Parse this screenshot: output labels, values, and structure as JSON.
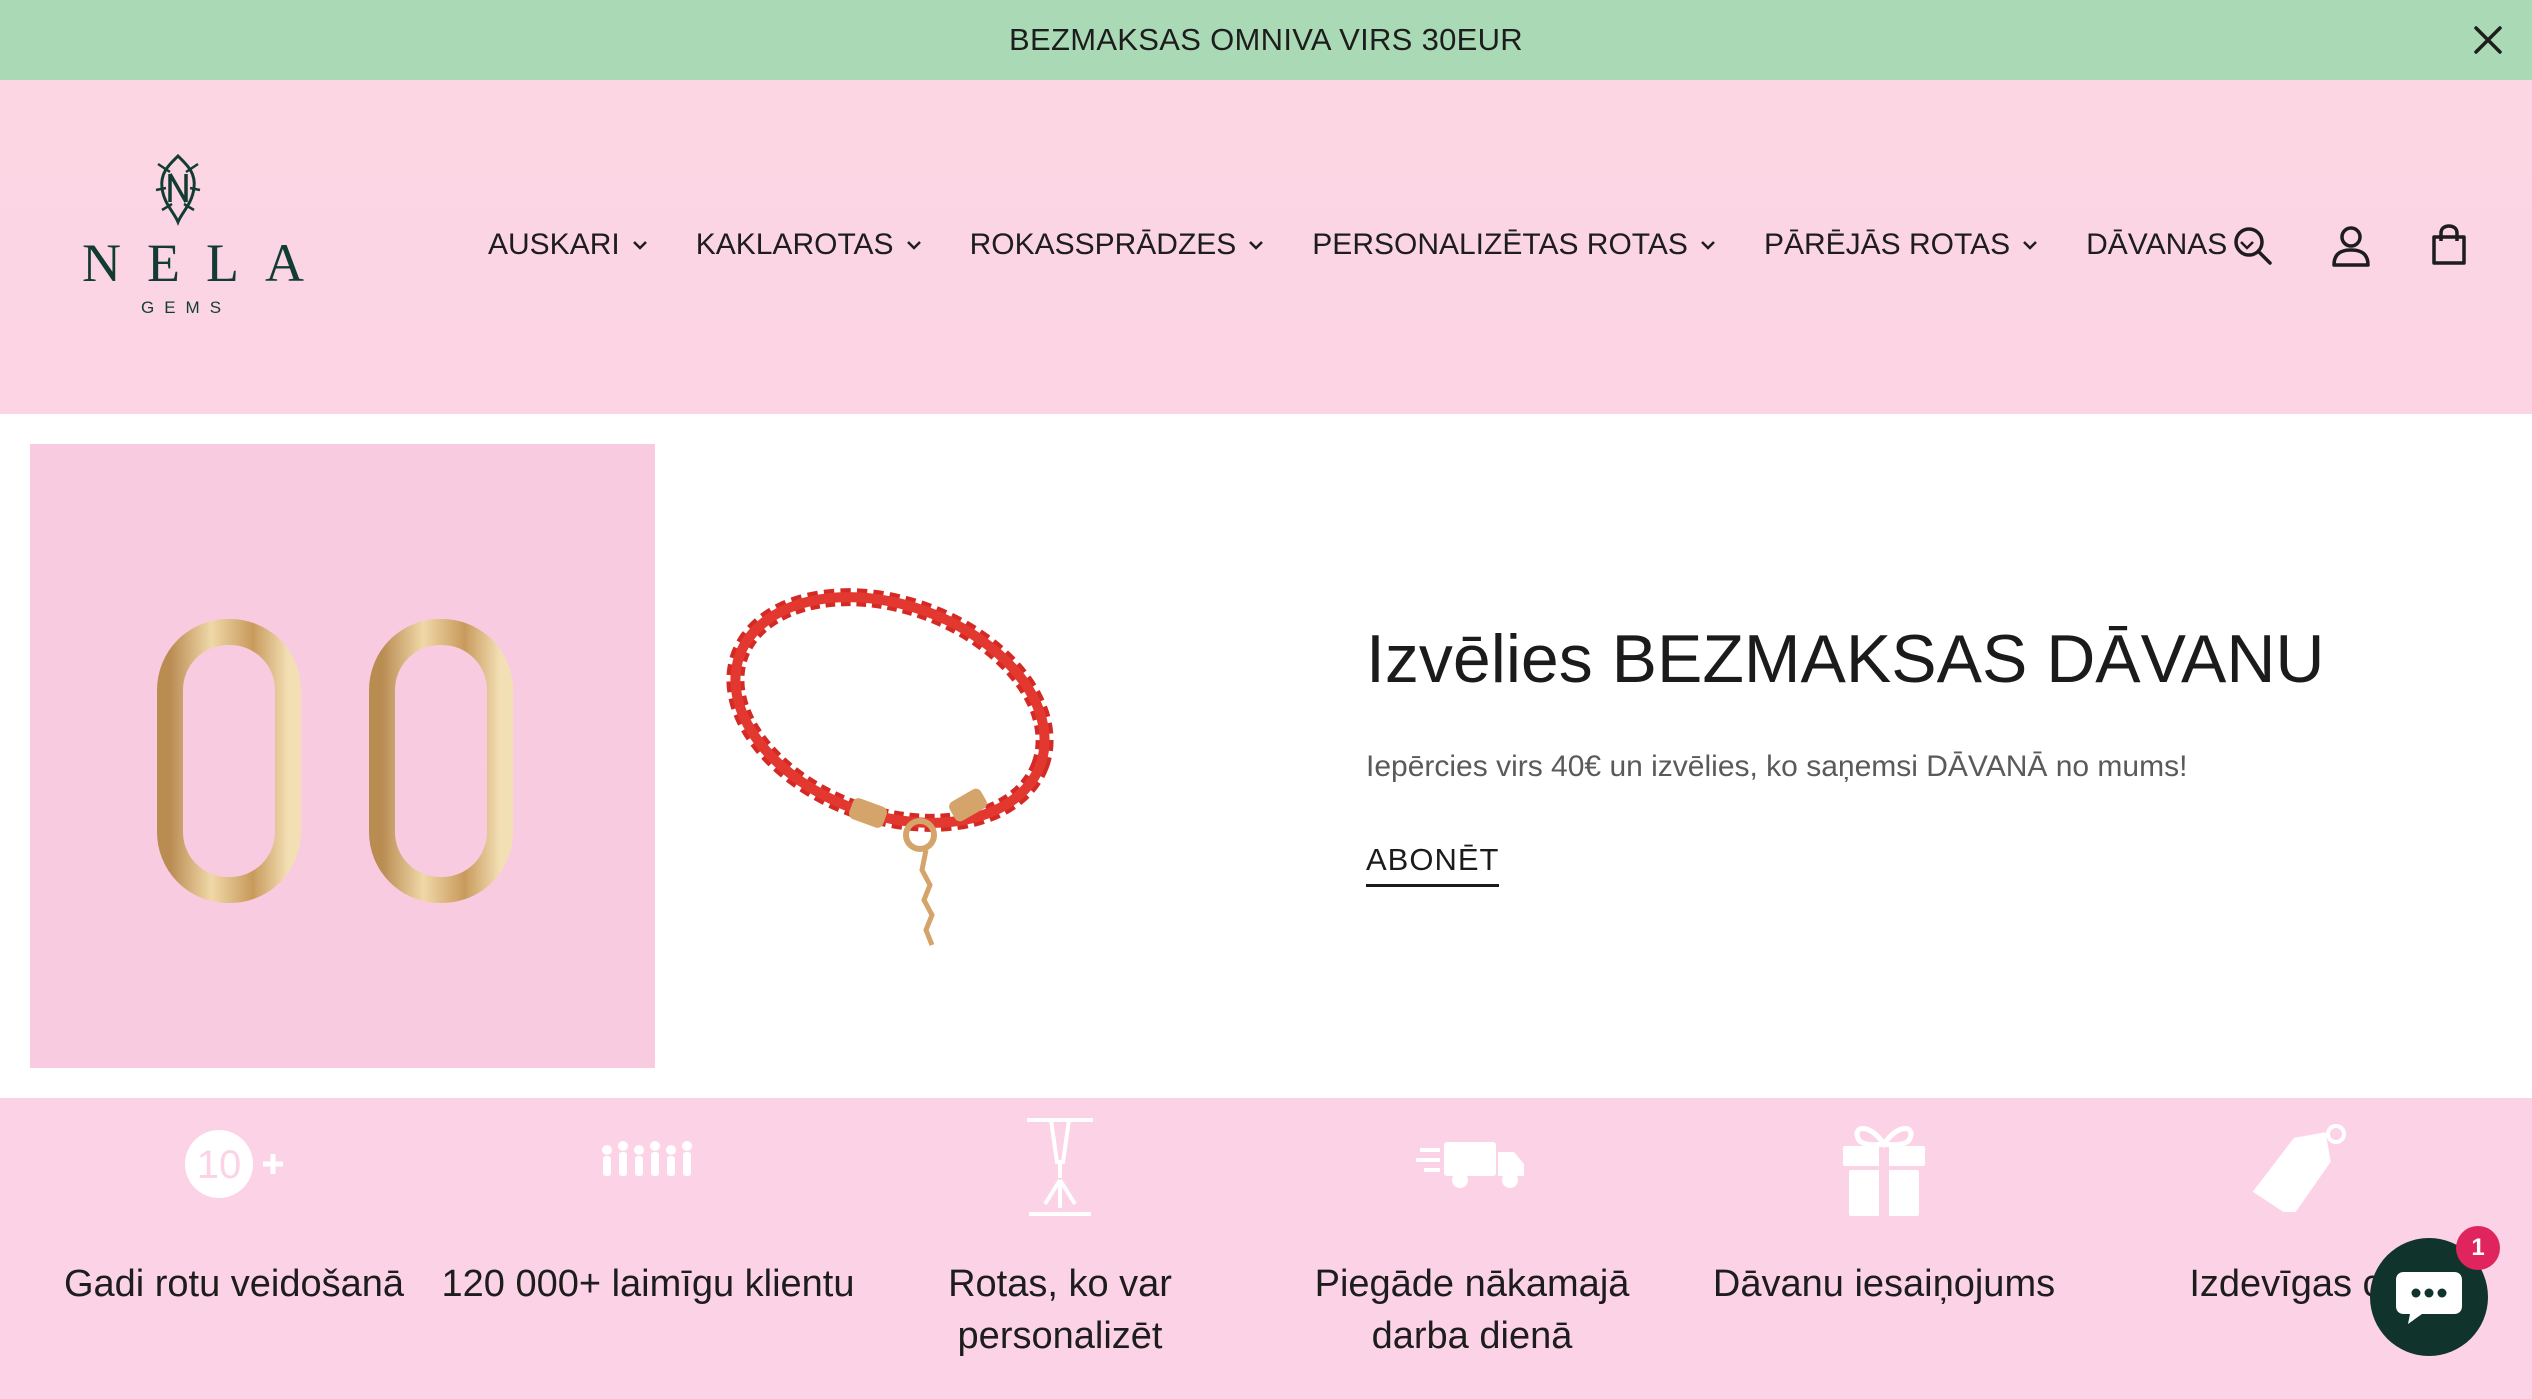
{
  "announcement": {
    "text": "BEZMAKSAS OMNIVA VIRS 30EUR"
  },
  "logo": {
    "name": "NELA",
    "tagline": "GEMS"
  },
  "nav": {
    "items": [
      {
        "label": "AUSKARI"
      },
      {
        "label": "KAKLAROTAS"
      },
      {
        "label": "ROKASSPRĀDZES"
      },
      {
        "label": "PERSONALIZĒTAS ROTAS"
      },
      {
        "label": "PĀRĒJĀS ROTAS"
      },
      {
        "label": "DĀVANAS"
      }
    ]
  },
  "header_icons": [
    "search-icon",
    "account-icon",
    "cart-icon"
  ],
  "hero": {
    "title": "Izvēlies BEZMAKSAS DĀVANU",
    "subtitle": "Iepērcies virs 40€ un izvēlies, ko saņemsi DĀVANĀ no mums!",
    "cta": "ABONĒT"
  },
  "features": [
    {
      "icon": "ten-plus-icon",
      "label": "Gadi rotu veidošanā"
    },
    {
      "icon": "crowd-icon",
      "label": "120 000+ laimīgu klientu"
    },
    {
      "icon": "engraving-icon",
      "label": "Rotas, ko var personalizēt"
    },
    {
      "icon": "delivery-truck-icon",
      "label": "Piegāde nākamajā darba dienā"
    },
    {
      "icon": "gift-icon",
      "label": "Dāvanu iesaiņojums"
    },
    {
      "icon": "price-tag-icon",
      "label": "Izdevīgas ce"
    }
  ],
  "chat": {
    "badge": "1"
  },
  "colors": {
    "announcement_bg": "#a9d9b5",
    "header_bg": "#fdd6e4",
    "features_bg": "#fcd3e6",
    "brand_green": "#123c33",
    "chat_bg": "#10342c",
    "badge": "#e0245e"
  }
}
